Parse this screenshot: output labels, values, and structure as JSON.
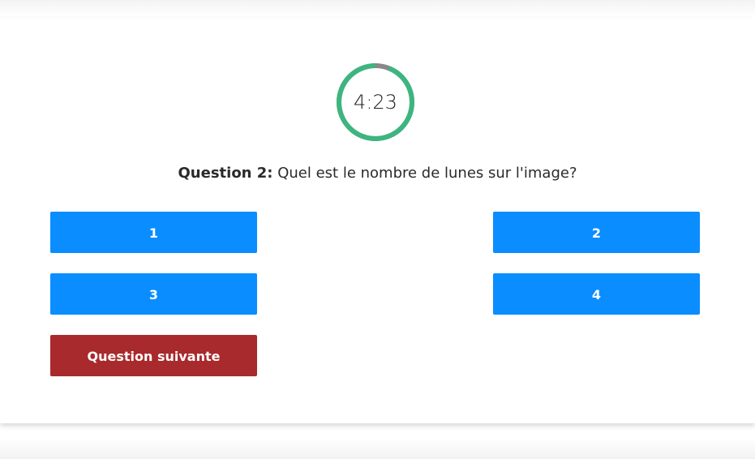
{
  "timer": {
    "display": "4:23",
    "remaining_fraction": 0.94,
    "ring_color": "#3db57f",
    "elapsed_color": "#888888"
  },
  "question": {
    "label": "Question 2:",
    "text": "Quel est le nombre de lunes sur l'image?"
  },
  "answers": [
    {
      "label": "1"
    },
    {
      "label": "2"
    },
    {
      "label": "3"
    },
    {
      "label": "4"
    }
  ],
  "next_button": {
    "label": "Question suivante"
  },
  "colors": {
    "answer_button": "#0a8dff",
    "next_button": "#a92a2c"
  }
}
